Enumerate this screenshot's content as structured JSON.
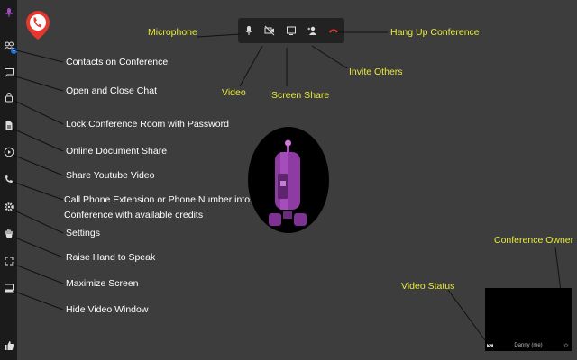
{
  "colors": {
    "background": "#3d3d3d",
    "sidebar": "#1b1b1b",
    "toolbar": "#222222",
    "callout_yellow": "#e8ea3c",
    "hangup_red": "#e2382f",
    "accent_purple": "#a24cc0"
  },
  "sidebar": {
    "items": [
      {
        "name": "mic-indicator",
        "icon": "microphone-icon"
      },
      {
        "name": "contacts",
        "icon": "contacts-icon",
        "badge": "1"
      },
      {
        "name": "chat",
        "icon": "chat-icon"
      },
      {
        "name": "lock",
        "icon": "lock-icon"
      },
      {
        "name": "document",
        "icon": "document-icon"
      },
      {
        "name": "youtube",
        "icon": "play-icon"
      },
      {
        "name": "phone",
        "icon": "phone-icon"
      },
      {
        "name": "settings",
        "icon": "gear-icon"
      },
      {
        "name": "raise-hand",
        "icon": "hand-icon"
      },
      {
        "name": "maximize",
        "icon": "maximize-icon"
      },
      {
        "name": "hide-video",
        "icon": "window-icon"
      },
      {
        "name": "like",
        "icon": "thumbs-up-icon"
      }
    ]
  },
  "toolbar": {
    "buttons": [
      "microphone-icon",
      "video-off-icon",
      "screen-share-icon",
      "invite-icon",
      "hang-up-icon"
    ]
  },
  "callouts": {
    "contacts": "Contacts on Conference",
    "chat": "Open and Close Chat",
    "lock": "Lock Conference Room with Password",
    "document": "Online Document Share",
    "youtube": "Share Youtube Video",
    "phone_line1": "Call Phone Extension or Phone Number into",
    "phone_line2": "Conference with available credits",
    "settings": "Settings",
    "raise_hand": "Raise Hand to Speak",
    "maximize": "Maximize Screen",
    "hide_video": "Hide Video Window",
    "microphone": "Microphone",
    "video": "Video",
    "screen_share": "Screen Share",
    "invite": "Invite Others",
    "hang_up": "Hang Up Conference",
    "video_status": "Video Status",
    "conference_owner": "Conference Owner"
  },
  "video_window": {
    "participant_name": "Danny (me)"
  }
}
